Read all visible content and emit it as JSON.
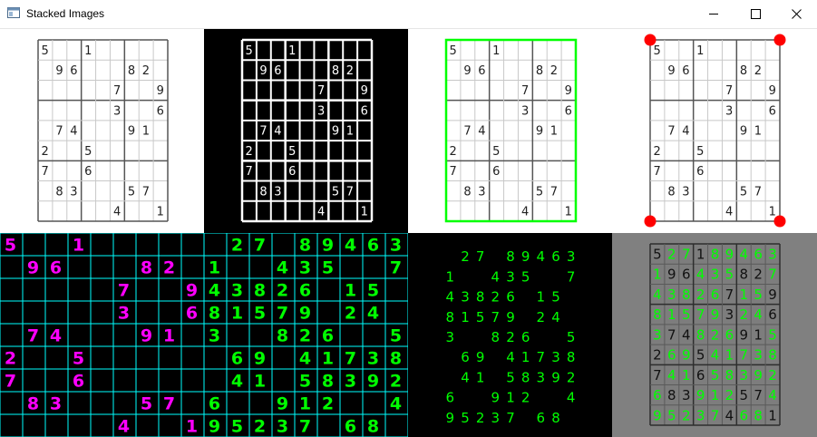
{
  "window": {
    "title": "Stacked Images"
  },
  "puzzle": [
    [
      "5",
      "",
      "",
      "1",
      "",
      "",
      "",
      "",
      ""
    ],
    [
      "",
      "9",
      "6",
      "",
      "",
      "",
      "8",
      "2",
      ""
    ],
    [
      "",
      "",
      "",
      "",
      "",
      "7",
      "",
      "",
      "9"
    ],
    [
      "",
      "",
      "",
      "",
      "",
      "3",
      "",
      "",
      "6"
    ],
    [
      "",
      "7",
      "4",
      "",
      "",
      "",
      "9",
      "1",
      ""
    ],
    [
      "2",
      "",
      "",
      "5",
      "",
      "",
      "",
      "",
      ""
    ],
    [
      "7",
      "",
      "",
      "6",
      "",
      "",
      "",
      "",
      ""
    ],
    [
      "",
      "8",
      "3",
      "",
      "",
      "",
      "5",
      "7",
      ""
    ],
    [
      "",
      "",
      "",
      "",
      "",
      "4",
      "",
      "",
      "1"
    ]
  ],
  "solution": [
    [
      "5",
      "2",
      "7",
      "1",
      "8",
      "9",
      "4",
      "6",
      "3"
    ],
    [
      "1",
      "9",
      "6",
      "4",
      "3",
      "5",
      "8",
      "2",
      "7"
    ],
    [
      "4",
      "3",
      "8",
      "2",
      "6",
      "7",
      "1",
      "5",
      "9"
    ],
    [
      "8",
      "1",
      "5",
      "7",
      "9",
      "3",
      "2",
      "4",
      "6"
    ],
    [
      "3",
      "7",
      "4",
      "8",
      "2",
      "6",
      "9",
      "1",
      "5"
    ],
    [
      "2",
      "6",
      "9",
      "5",
      "4",
      "1",
      "7",
      "3",
      "8"
    ],
    [
      "7",
      "4",
      "1",
      "6",
      "5",
      "8",
      "3",
      "9",
      "2"
    ],
    [
      "6",
      "8",
      "3",
      "9",
      "1",
      "2",
      "5",
      "7",
      "4"
    ],
    [
      "9",
      "5",
      "2",
      "3",
      "7",
      "4",
      "6",
      "8",
      "1"
    ]
  ],
  "colors": {
    "given_digit": "#ff00ff",
    "solved_digit": "#00ff00",
    "grid_cyan": "#00ffff",
    "green_outline": "#00ff00",
    "corner_dot": "#ff0000",
    "gray_bg": "#808080"
  },
  "icons": {
    "app": "window-app-icon",
    "minimize": "minimize-icon",
    "maximize": "maximize-icon",
    "close": "close-icon"
  }
}
